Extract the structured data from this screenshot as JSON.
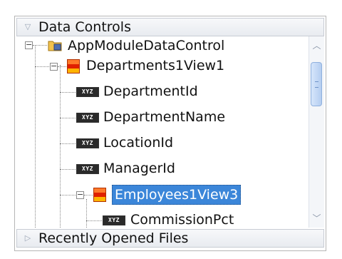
{
  "panels": {
    "data_controls_label": "Data Controls",
    "recently_opened_label": "Recently Opened Files"
  },
  "tree": {
    "root_label": "AppModuleDataControl",
    "departments_label": "Departments1View1",
    "attributes": [
      "DepartmentId",
      "DepartmentName",
      "LocationId",
      "ManagerId"
    ],
    "employees_label": "Employees1View3",
    "employees_child_label": "CommissionPct",
    "attr_icon_text": "XYZ"
  },
  "colors": {
    "selection": "#3b86d9",
    "table_icon_top": "#ff7a2a",
    "table_icon_mid": "#e02000"
  },
  "scrollbar": {
    "position_fraction": 0.15
  }
}
